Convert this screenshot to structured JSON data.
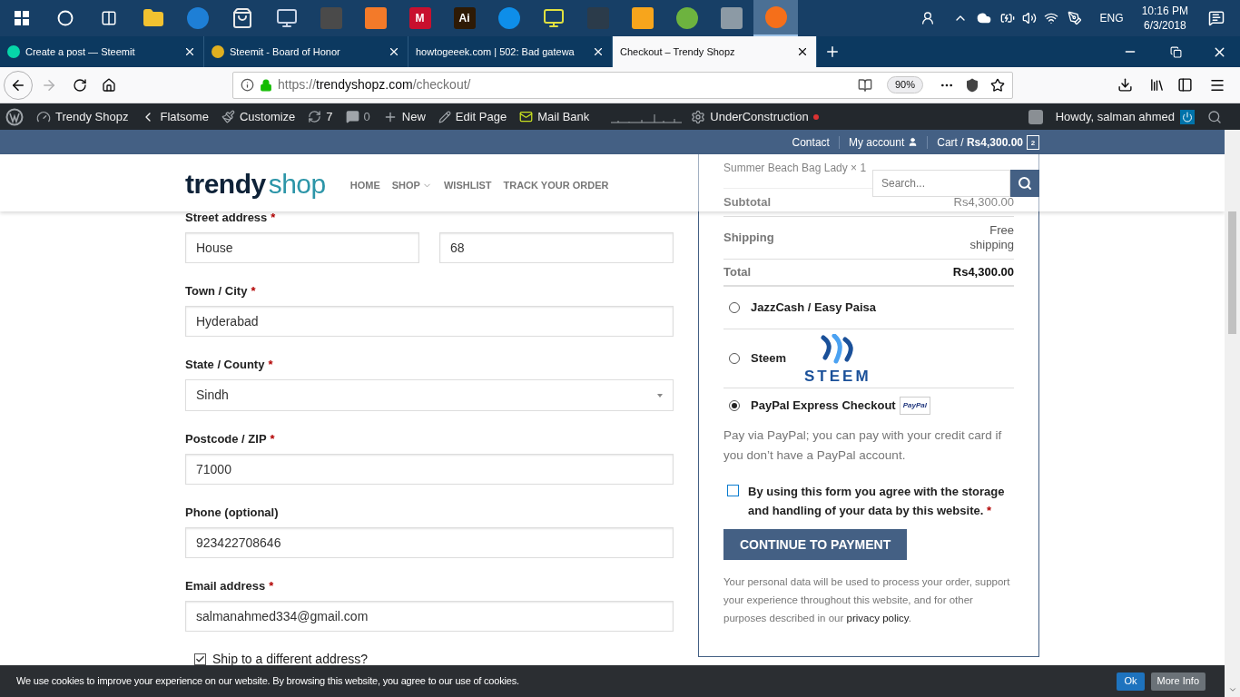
{
  "taskbar": {
    "apps": [
      {
        "kind": "folder",
        "color": "#f2c230",
        "selected": false
      },
      {
        "kind": "circle",
        "color": "#1e7fd6",
        "selected": false
      },
      {
        "kind": "bag",
        "color": "#e8e8e8",
        "selected": false
      },
      {
        "kind": "monitor",
        "color": "#c9d4e6",
        "selected": false
      },
      {
        "kind": "tile",
        "color": "#4a4a4a",
        "selected": false
      },
      {
        "kind": "tile",
        "color": "#f37a29",
        "selected": false
      },
      {
        "kind": "tile",
        "color": "#c8102e",
        "label": "M",
        "selected": false
      },
      {
        "kind": "tile",
        "color": "#2e1a05",
        "label": "Ai",
        "selected": false
      },
      {
        "kind": "circle",
        "color": "#0e8ee9",
        "selected": false
      },
      {
        "kind": "monitor",
        "color": "#e0e040",
        "selected": false
      },
      {
        "kind": "tile",
        "color": "#2b3b4a",
        "selected": false
      },
      {
        "kind": "tile",
        "color": "#f7a51c",
        "selected": false
      },
      {
        "kind": "circle",
        "color": "#6db33f",
        "selected": false
      },
      {
        "kind": "tile",
        "color": "#8c9aa5",
        "selected": false
      },
      {
        "kind": "circle",
        "color": "#f56f1a",
        "selected": true
      }
    ],
    "language": "ENG",
    "time": "10:16 PM",
    "date": "6/3/2018"
  },
  "tabs": [
    {
      "title": "Create a post — Steemit",
      "color": "#06d6a9",
      "selected": false
    },
    {
      "title": "Steemit - Board of Honor",
      "color": "#e0b020",
      "selected": false
    },
    {
      "title": "howtogeeek.com | 502: Bad gatewa",
      "selected": false
    },
    {
      "title": "Checkout – Trendy Shopz",
      "selected": true
    }
  ],
  "nav": {
    "forward_disabled": true,
    "url": {
      "scheme": "https://",
      "host": "trendyshopz.com",
      "path": "/checkout/"
    },
    "zoom": "90%"
  },
  "admin_bar": {
    "items": [
      {
        "label": "Trendy Shopz"
      },
      {
        "label": "Flatsome"
      },
      {
        "label": "Customize"
      },
      {
        "label": "7"
      },
      {
        "label": "0"
      },
      {
        "label": "New"
      },
      {
        "label": "Edit Page"
      },
      {
        "label": "Mail Bank"
      },
      {
        "label": "UnderConstruction",
        "color": "#dc3232"
      }
    ],
    "greeting": "Howdy, salman ahmed"
  },
  "top_bar": {
    "links": [
      "Contact",
      "My account"
    ],
    "cart": {
      "label": "Cart /",
      "amount": "Rs4,300.00",
      "count": "2"
    }
  },
  "header": {
    "logo": {
      "first": "trendy",
      "second": "shop"
    },
    "menu": [
      {
        "label": "HOME",
        "dropdown": false
      },
      {
        "label": "SHOP",
        "dropdown": true
      },
      {
        "label": "WISHLIST",
        "dropdown": false
      },
      {
        "label": "TRACK YOUR ORDER",
        "dropdown": false
      }
    ],
    "search": {
      "placeholder": "Search..."
    }
  },
  "required_mark": "*",
  "form": {
    "fields": [
      {
        "kind": "split",
        "label": "Street address",
        "required": true,
        "values": [
          "House",
          "68"
        ]
      },
      {
        "kind": "text",
        "label": "Town / City",
        "required": true,
        "value": "Hyderabad"
      },
      {
        "kind": "select",
        "label": "State / County",
        "required": true,
        "value": "Sindh"
      },
      {
        "kind": "text",
        "label": "Postcode / ZIP",
        "required": true,
        "value": "71000"
      },
      {
        "kind": "text",
        "label": "Phone (optional)",
        "required": false,
        "value": "923422708646"
      },
      {
        "kind": "text",
        "label": "Email address",
        "required": true,
        "value": "salmanahmed334@gmail.com"
      }
    ],
    "ship_different": {
      "label": "Ship to a different address?",
      "checked": true
    }
  },
  "order": {
    "item": "Summer Beach Bag Lady × 1",
    "rows": [
      {
        "kind": "subtotal",
        "label": "Subtotal",
        "value": "Rs4,300.00"
      },
      {
        "kind": "shipping",
        "label": "Shipping",
        "value": "Free shipping"
      },
      {
        "kind": "total",
        "label": "Total",
        "value": "Rs4,300.00"
      }
    ]
  },
  "payment": {
    "methods": [
      {
        "label": "JazzCash / Easy Paisa",
        "selected": false
      },
      {
        "label": "Steem",
        "selected": false,
        "logo": {
          "kind": "steem",
          "text": "STEEM"
        }
      },
      {
        "label": "PayPal Express Checkout",
        "selected": true,
        "logo": {
          "kind": "paypal",
          "text": "PayPal"
        }
      }
    ],
    "description": "Pay via PayPal; you can pay with your credit card if you don’t have a PayPal account.",
    "consent": {
      "text": "By using this form you agree with the storage and handling of your data by this website.",
      "checked": false
    },
    "button": "CONTINUE TO PAYMENT",
    "privacy": {
      "before": "Your personal data will be used to process your order, support your experience throughout this website, and for other purposes described in our ",
      "link": "privacy policy",
      "after": "."
    }
  },
  "cookie_bar": {
    "text": "We use cookies to improve your experience on our website. By browsing this website, you agree to our use of cookies.",
    "buttons": [
      "Ok",
      "More Info"
    ]
  }
}
